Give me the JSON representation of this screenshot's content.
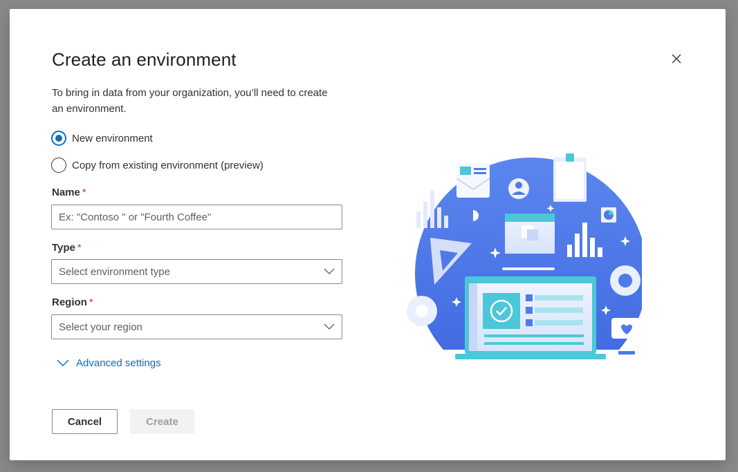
{
  "dialog": {
    "title": "Create an environment",
    "subtitle": "To bring in data from your organization, you’ll need to create an environment.",
    "close_icon": "close-icon"
  },
  "environment_options": [
    {
      "label": "New environment",
      "checked": true
    },
    {
      "label": "Copy from existing environment (preview)",
      "checked": false
    }
  ],
  "fields": {
    "name": {
      "label": "Name",
      "required_mark": "*",
      "placeholder": "Ex: \"Contoso \" or \"Fourth Coffee\"",
      "value": ""
    },
    "type": {
      "label": "Type",
      "required_mark": "*",
      "placeholder": "Select environment type"
    },
    "region": {
      "label": "Region",
      "required_mark": "*",
      "placeholder": "Select your region"
    }
  },
  "advanced_settings": {
    "label": "Advanced settings",
    "icon": "chevron-down-icon"
  },
  "buttons": {
    "cancel": "Cancel",
    "create": "Create"
  },
  "colors": {
    "accent": "#0f6cbd",
    "required": "#c4314b",
    "illustration_blue": "#4f7ae8",
    "illustration_teal": "#4cc7d9"
  }
}
